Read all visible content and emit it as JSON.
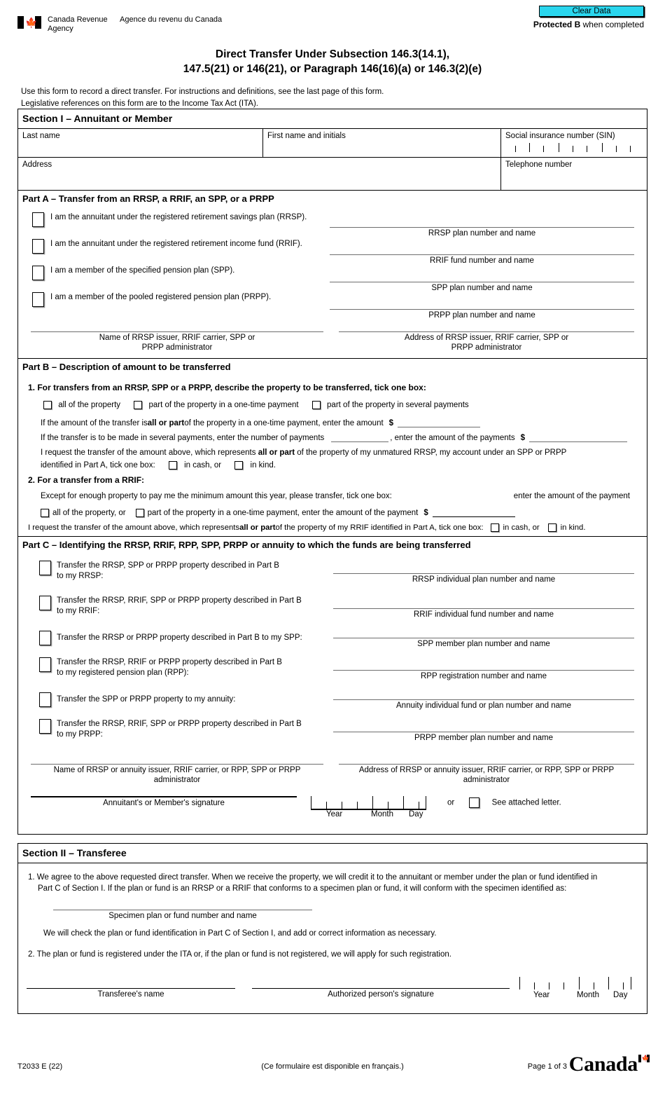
{
  "header": {
    "agency_en": "Canada Revenue Agency",
    "agency_fr": "Agence du revenu du Canada",
    "clear_data_label": "Clear Data",
    "protected_prefix": "Protected B",
    "protected_suffix": " when completed",
    "accent_color": "#2ad6ee",
    "title_line1": "Direct Transfer Under Subsection 146.3(14.1),",
    "title_line2": "147.5(21) or 146(21), or Paragraph 146(16)(a) or 146.3(2)(e)",
    "intro_line1": "Use this form to record a direct transfer. For instructions and definitions, see the last page of this form.",
    "intro_line2": "Legislative references on this form are to the Income Tax Act (ITA)."
  },
  "section1": {
    "heading": "Section I – Annuitant or Member",
    "last_name_label": "Last name",
    "first_name_label": "First name and initials",
    "sin_label": "Social insurance number (SIN)",
    "address_label": "Address",
    "telephone_label": "Telephone number"
  },
  "partA": {
    "heading": "Part A – Transfer from an RRSP, a RRIF, an SPP, or a PRPP",
    "items": [
      {
        "label": "I am the annuitant under the registered retirement savings plan (RRSP).",
        "caption": "RRSP plan number and name"
      },
      {
        "label": "I am the annuitant under the registered retirement income fund (RRIF).",
        "caption": "RRIF fund number and name"
      },
      {
        "label": "I am a member of the specified pension plan (SPP).",
        "caption": "SPP plan number and name"
      },
      {
        "label": "I am a member of the pooled registered pension plan (PRPP).",
        "caption": "PRPP plan number and name"
      }
    ],
    "name_caption_l1": "Name of RRSP issuer, RRIF carrier, SPP or",
    "name_caption_l2": "PRPP administrator",
    "addr_caption_l1": "Address of RRSP issuer, RRIF carrier, SPP or",
    "addr_caption_l2": "PRPP administrator"
  },
  "partB": {
    "heading": "Part B – Description of amount to be transferred",
    "q1_heading": "1. For transfers from an RRSP, SPP or a PRPP, describe the property to be transferred, tick one box:",
    "q1_opt1": "all of the property",
    "q1_opt2": "part of the property in a one-time payment",
    "q1_opt3": "part of the property in several payments",
    "line1_a": "If the amount of the transfer is ",
    "line1_b": "all or part",
    "line1_c": " of the property in a one-time payment, enter the amount",
    "dollar": "$",
    "line2_a": "If the transfer is to be made in several payments, enter the number of payments",
    "line2_b": ", enter the amount of the payments",
    "line3_a": "I request the transfer of the amount above, which represents ",
    "line3_b": "all or part",
    "line3_c": " of the property of my unmatured RRSP, my account under an SPP or PRPP",
    "line4_a": "identified in Part A, tick one box:",
    "in_cash": "in cash, or",
    "in_kind": "in kind.",
    "q2_heading": "2. For a transfer from a RRIF:",
    "q2_line1": "Except for enough property to pay me the minimum amount this year, please transfer, tick one box:",
    "q2_hint": "enter the amount of the payment",
    "q2_opt1": "all of the property, or",
    "q2_opt2": "part of the property in a one-time payment, enter the amount of the payment",
    "q2_last_a": "I request the transfer of the amount above, which represents ",
    "q2_last_b": "all or part",
    "q2_last_c": " of the property of my RRIF identified in Part A, tick one box:"
  },
  "partC": {
    "heading": "Part C – Identifying the RRSP, RRIF, RPP, SPP, PRPP or annuity to which the funds are being transferred",
    "items": [
      {
        "l1": "Transfer the RRSP, SPP or PRPP property described in Part B",
        "l2": "to my RRSP:",
        "caption": "RRSP individual plan number and name"
      },
      {
        "l1": "Transfer the RRSP, RRIF, SPP or PRPP property described in Part B",
        "l2": "to my RRIF:",
        "caption": "RRIF individual fund number and name"
      },
      {
        "l1": "Transfer the RRSP or PRPP property described in Part B to my SPP:",
        "l2": "",
        "caption": "SPP member plan number and name"
      },
      {
        "l1": "Transfer the RRSP, RRIF or PRPP property described in Part B",
        "l2": "to my registered pension plan (RPP):",
        "caption": "RPP registration number and name"
      },
      {
        "l1": "Transfer the SPP or PRPP property to my annuity:",
        "l2": "",
        "caption": "Annuity individual fund or plan number and name"
      },
      {
        "l1": "Transfer the RRSP, RRIF, SPP or PRPP property described in Part B",
        "l2": "to my PRPP:",
        "caption": "PRPP member plan number and name"
      }
    ],
    "name_caption_l1": "Name of RRSP or annuity issuer, RRIF carrier, or RPP, SPP or PRPP",
    "name_caption_l2": "administrator",
    "addr_caption_l1": "Address of RRSP or annuity issuer, RRIF carrier, or RPP, SPP or PRPP",
    "addr_caption_l2": "administrator",
    "signature_caption": "Annuitant's or Member's signature",
    "date_year": "Year",
    "date_month": "Month",
    "date_day": "Day",
    "or_label": "or",
    "attached_letter": "See attached letter."
  },
  "section2": {
    "heading": "Section II – Transferee",
    "p1_l1": "1. We agree to the above requested direct transfer. When we receive the property, we will credit it to the annuitant or member under the plan or fund identified in",
    "p1_l2": "Part C of Section I. If the plan or fund is an RRSP or a RRIF that conforms to a specimen plan or fund, it will conform with the specimen identified as:",
    "specimen_caption": "Specimen plan or fund number and name",
    "p1_l3": "We will check the plan or fund identification in Part C of Section I, and add or correct information as necessary.",
    "p2": "2. The plan or fund is registered under the ITA or, if the plan or fund is not registered, we will apply for such registration.",
    "transferee_name_caption": "Transferee's name",
    "authorized_sig_caption": "Authorized person's signature",
    "date_year": "Year",
    "date_month": "Month",
    "date_day": "Day"
  },
  "footer": {
    "form_code": "T2033 E (22)",
    "french_note": "(Ce formulaire est disponible en français.)",
    "page_label": "Page 1 of 3",
    "wordmark": "Canada"
  }
}
